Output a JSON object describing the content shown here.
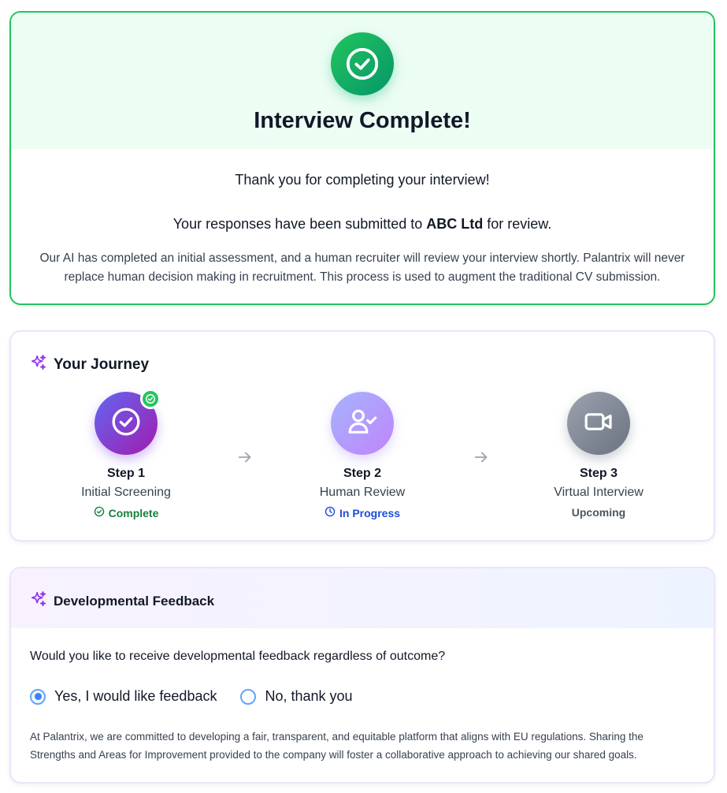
{
  "completion": {
    "title": "Interview Complete!",
    "thanks": "Thank you for completing your interview!",
    "submitted_prefix": "Your responses have been submitted to",
    "company": "ABC Ltd",
    "submitted_suffix": "for review.",
    "ai_note": "Our AI has completed an initial assessment, and a human recruiter will review your interview shortly. Palantrix will never replace human decision making in recruitment. This process is used to augment the traditional CV submission.",
    "icon": "check-circle-icon",
    "accent": "#22c55e"
  },
  "journey": {
    "title": "Your Journey",
    "icon": "sparkles-icon",
    "steps": [
      {
        "step": "Step 1",
        "name": "Initial Screening",
        "status": "Complete",
        "icon": "check-circle-icon",
        "status_icon": "check-circle-icon",
        "status_color": "#15803d"
      },
      {
        "step": "Step 2",
        "name": "Human Review",
        "status": "In Progress",
        "icon": "user-check-icon",
        "status_icon": "clock-icon",
        "status_color": "#1d4ed8"
      },
      {
        "step": "Step 3",
        "name": "Virtual Interview",
        "status": "Upcoming",
        "icon": "video-camera-icon",
        "status_color": "#4b5563"
      }
    ]
  },
  "feedback": {
    "title": "Developmental Feedback",
    "icon": "sparkles-icon",
    "question": "Would you like to receive developmental feedback regardless of outcome?",
    "options": [
      {
        "label": "Yes, I would like feedback",
        "selected": true
      },
      {
        "label": "No, thank you",
        "selected": false
      }
    ],
    "policy": "At Palantrix, we are committed to developing a fair, transparent, and equitable platform that aligns with EU regulations. Sharing the Strengths and Areas for Improvement provided to the company will foster a collaborative approach to achieving our shared goals."
  }
}
